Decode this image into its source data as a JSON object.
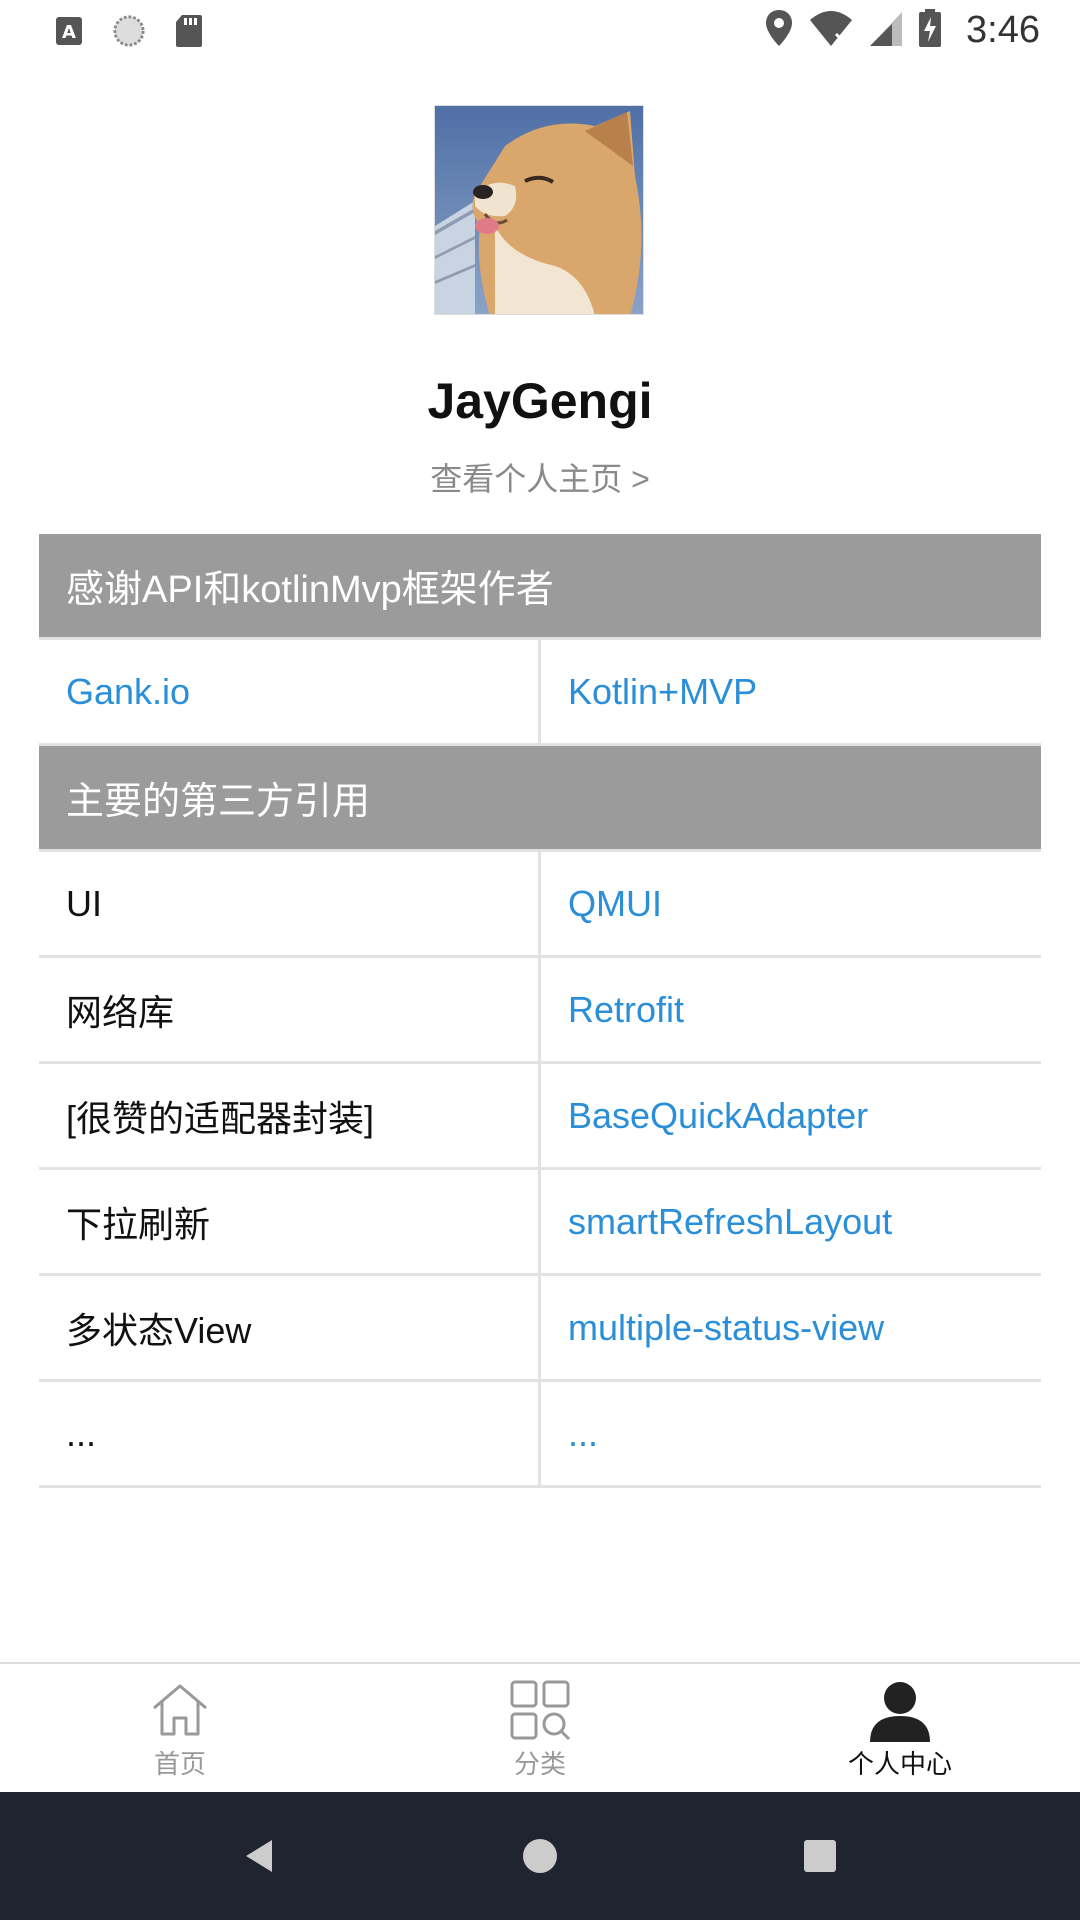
{
  "status_bar": {
    "time": "3:46",
    "left_icons": [
      "text-a-icon",
      "sync-icon",
      "sd-card-icon"
    ],
    "right_icons": [
      "location-icon",
      "wifi-off-icon",
      "signal-icon",
      "battery-charging-icon"
    ]
  },
  "profile": {
    "name": "JayGengi",
    "view_homepage": "查看个人主页 >"
  },
  "sections": [
    {
      "header": "感谢API和kotlinMvp框架作者",
      "rows": [
        {
          "left": "Gank.io",
          "left_is_link": true,
          "right": "Kotlin+MVP"
        }
      ]
    },
    {
      "header": "主要的第三方引用",
      "rows": [
        {
          "left": "UI",
          "right": "QMUI"
        },
        {
          "left": "网络库",
          "right": "Retrofit"
        },
        {
          "left": "[很赞的适配器封装]",
          "right": "BaseQuickAdapter"
        },
        {
          "left": "下拉刷新",
          "right": "smartRefreshLayout"
        },
        {
          "left": "多状态View",
          "right": "multiple-status-view"
        },
        {
          "left": "...",
          "right": "..."
        }
      ]
    }
  ],
  "tabs": [
    {
      "label": "首页",
      "icon": "home-icon",
      "active": false
    },
    {
      "label": "分类",
      "icon": "category-icon",
      "active": false
    },
    {
      "label": "个人中心",
      "icon": "person-icon",
      "active": true
    }
  ],
  "colors": {
    "link": "#2a8fd8",
    "section_header_bg": "#9b9b9b",
    "nav_bar_bg": "#1f2430"
  }
}
